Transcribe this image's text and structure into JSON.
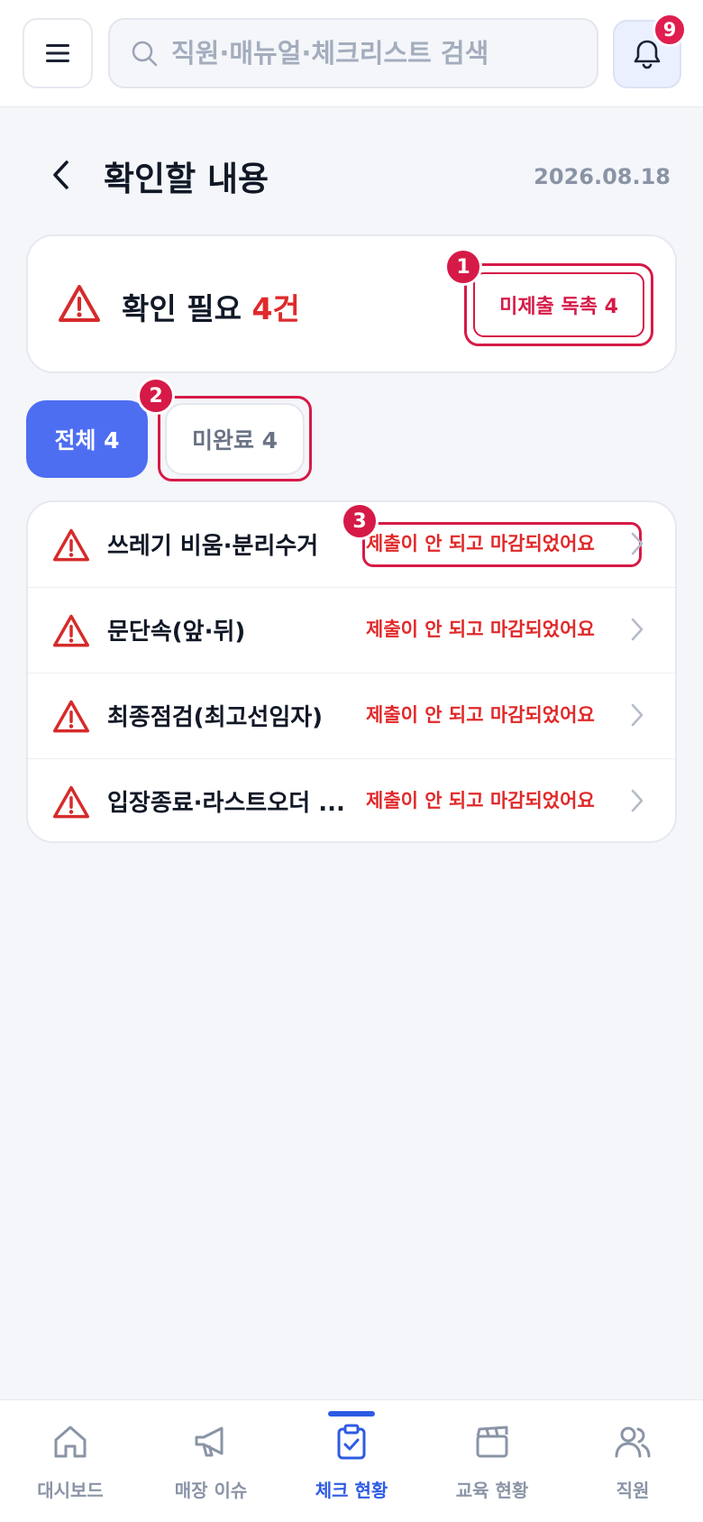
{
  "header": {
    "search_placeholder": "직원·매뉴얼·체크리스트 검색",
    "notification_count": "9"
  },
  "page": {
    "title": "확인할 내용",
    "date": "2026.08.18"
  },
  "summary": {
    "label": "확인 필요",
    "count": "4건",
    "nudge_button": "미제출 독촉 4"
  },
  "tabs": [
    {
      "label": "전체 4",
      "selected": true
    },
    {
      "label": "미완료 4",
      "selected": false
    }
  ],
  "items": [
    {
      "title": "쓰레기 비움·분리수거",
      "status": "제출이 안 되고 마감되었어요"
    },
    {
      "title": "문단속(앞·뒤)",
      "status": "제출이 안 되고 마감되었어요"
    },
    {
      "title": "최종점검(최고선임자)",
      "status": "제출이 안 되고 마감되었어요"
    },
    {
      "title": "입장종료·라스트오더 ...",
      "status": "제출이 안 되고 마감되었어요"
    }
  ],
  "annotations": [
    "1",
    "2",
    "3"
  ],
  "nav": [
    {
      "label": "대시보드",
      "icon": "home-icon"
    },
    {
      "label": "매장 이슈",
      "icon": "megaphone-icon"
    },
    {
      "label": "체크 현황",
      "icon": "clipboard-check-icon",
      "active": true
    },
    {
      "label": "교육 현황",
      "icon": "clapperboard-icon"
    },
    {
      "label": "직원",
      "icon": "users-icon"
    }
  ],
  "colors": {
    "accent": "#4e6ef2",
    "alert": "#e0292a",
    "annotation": "#d61a47",
    "nav_active": "#2d5be3"
  }
}
